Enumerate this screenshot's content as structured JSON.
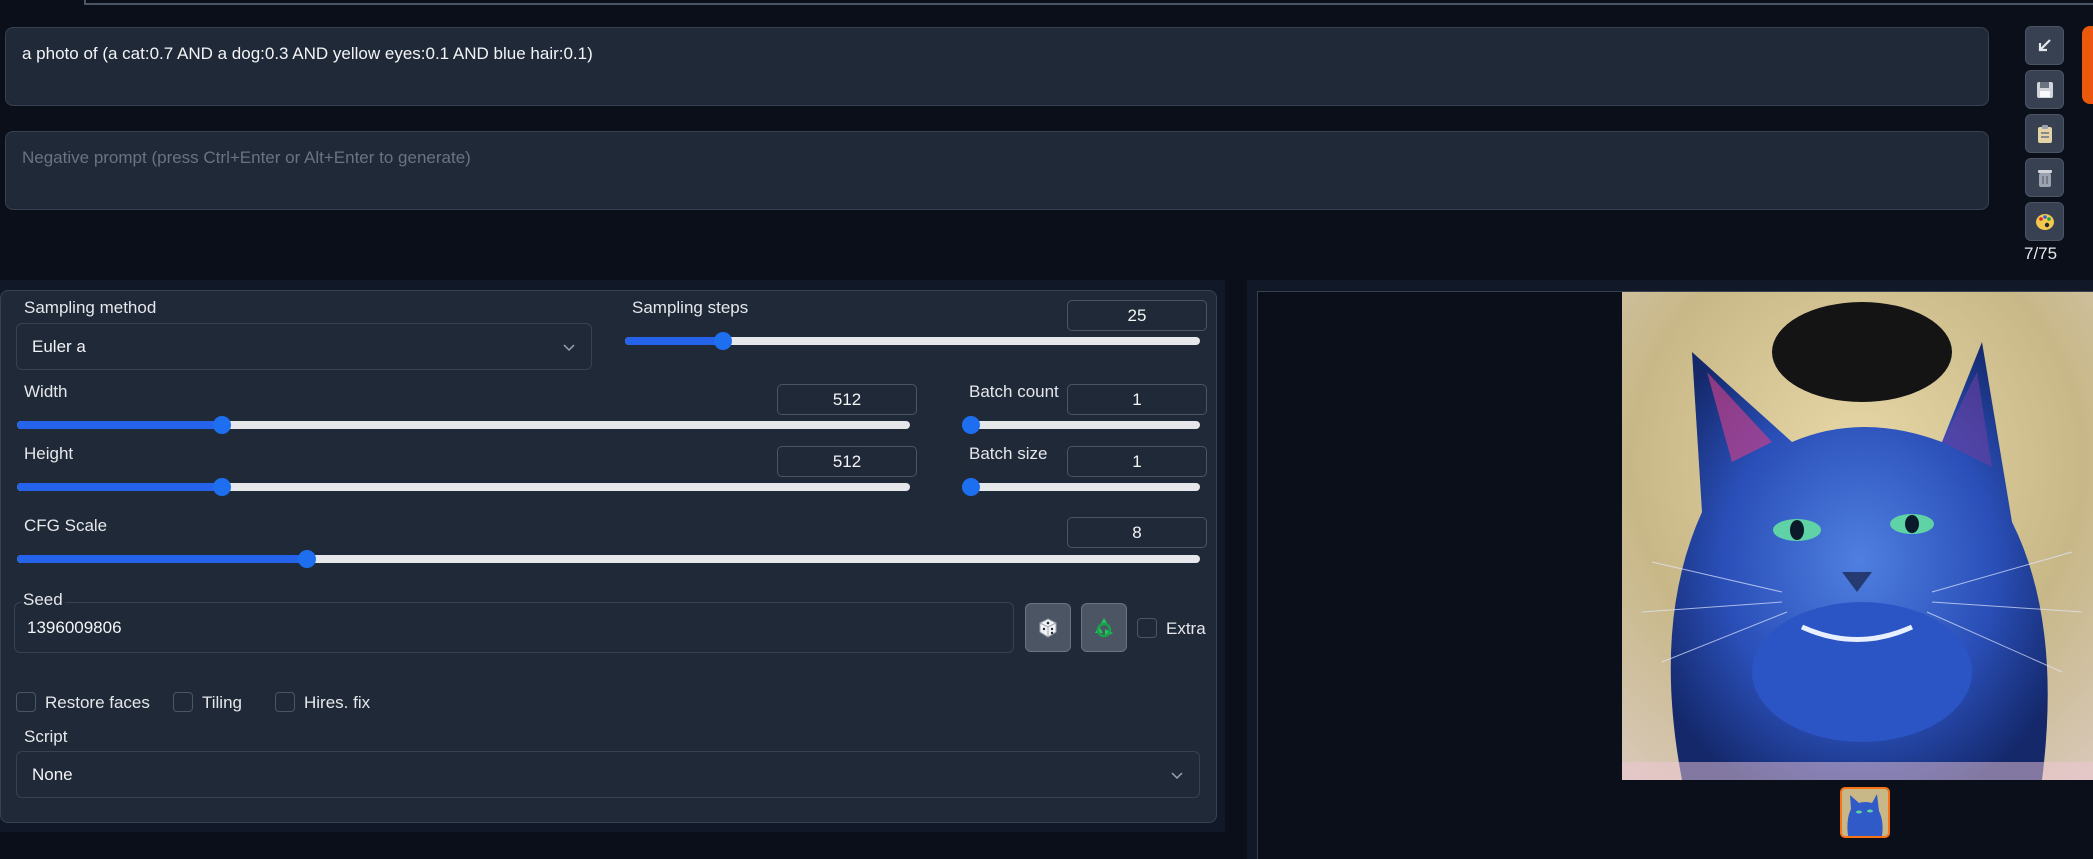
{
  "prompt": {
    "positive": "a photo of (a cat:0.7  AND a dog:0.3 AND yellow eyes:0.1 AND blue hair:0.1)",
    "negative_placeholder": "Negative prompt (press Ctrl+Enter or Alt+Enter to generate)"
  },
  "side_tools": {
    "token_count": "7/75",
    "icons": [
      "arrow-icon",
      "save-icon",
      "clipboard-icon",
      "trash-icon",
      "palette-icon"
    ]
  },
  "sampling": {
    "method_label": "Sampling method",
    "method_value": "Euler a",
    "steps_label": "Sampling steps",
    "steps_value": "25",
    "steps_fraction": 0.17
  },
  "size": {
    "width_label": "Width",
    "width_value": "512",
    "width_fraction": 0.23,
    "height_label": "Height",
    "height_value": "512",
    "height_fraction": 0.23
  },
  "batch": {
    "count_label": "Batch count",
    "count_value": "1",
    "count_fraction": 0.0,
    "size_label": "Batch size",
    "size_value": "1",
    "size_fraction": 0.0
  },
  "cfg": {
    "label": "CFG Scale",
    "value": "8",
    "fraction": 0.245
  },
  "seed": {
    "label": "Seed",
    "value": "1396009806",
    "extra_label": "Extra"
  },
  "options": {
    "restore_faces": "Restore faces",
    "tiling": "Tiling",
    "hires_fix": "Hires. fix"
  },
  "script": {
    "label": "Script",
    "value": "None"
  },
  "colors": {
    "accent": "#2563eb",
    "thumb_border": "#f97316"
  }
}
